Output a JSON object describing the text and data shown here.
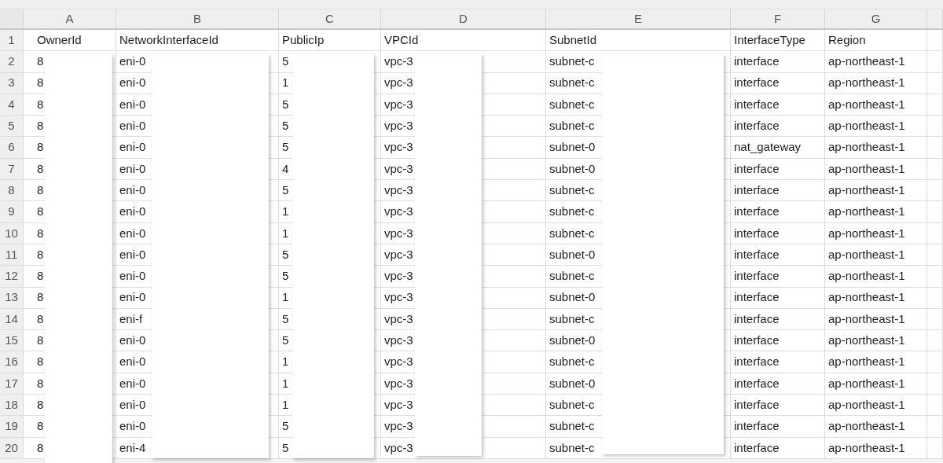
{
  "columns": [
    "A",
    "B",
    "C",
    "D",
    "E",
    "F",
    "G"
  ],
  "rows": [
    {
      "number": "1",
      "cells": [
        "OwnerId",
        "NetworkInterfaceId",
        "PublicIp",
        "VPCId",
        "SubnetId",
        "InterfaceType",
        "Region"
      ]
    },
    {
      "number": "2",
      "cells": [
        "8",
        "eni-0",
        "5",
        "vpc-3",
        "subnet-c",
        "interface",
        "ap-northeast-1"
      ]
    },
    {
      "number": "3",
      "cells": [
        "8",
        "eni-0",
        "1",
        "vpc-3",
        "subnet-c",
        "interface",
        "ap-northeast-1"
      ]
    },
    {
      "number": "4",
      "cells": [
        "8",
        "eni-0",
        "5",
        "vpc-3",
        "subnet-c",
        "interface",
        "ap-northeast-1"
      ]
    },
    {
      "number": "5",
      "cells": [
        "8",
        "eni-0",
        "5",
        "vpc-3",
        "subnet-c",
        "interface",
        "ap-northeast-1"
      ]
    },
    {
      "number": "6",
      "cells": [
        "8",
        "eni-0",
        "5",
        "vpc-3",
        "subnet-0",
        "nat_gateway",
        "ap-northeast-1"
      ]
    },
    {
      "number": "7",
      "cells": [
        "8",
        "eni-0",
        "4",
        "vpc-3",
        "subnet-0",
        "interface",
        "ap-northeast-1"
      ]
    },
    {
      "number": "8",
      "cells": [
        "8",
        "eni-0",
        "5",
        "vpc-3",
        "subnet-c",
        "interface",
        "ap-northeast-1"
      ]
    },
    {
      "number": "9",
      "cells": [
        "8",
        "eni-0",
        "1",
        "vpc-3",
        "subnet-c",
        "interface",
        "ap-northeast-1"
      ]
    },
    {
      "number": "10",
      "cells": [
        "8",
        "eni-0",
        "1",
        "vpc-3",
        "subnet-c",
        "interface",
        "ap-northeast-1"
      ]
    },
    {
      "number": "11",
      "cells": [
        "8",
        "eni-0",
        "5",
        "vpc-3",
        "subnet-0",
        "interface",
        "ap-northeast-1"
      ]
    },
    {
      "number": "12",
      "cells": [
        "8",
        "eni-0",
        "5",
        "vpc-3",
        "subnet-c",
        "interface",
        "ap-northeast-1"
      ]
    },
    {
      "number": "13",
      "cells": [
        "8",
        "eni-0",
        "1",
        "vpc-3",
        "subnet-0",
        "interface",
        "ap-northeast-1"
      ]
    },
    {
      "number": "14",
      "cells": [
        "8",
        "eni-f",
        "5",
        "vpc-3",
        "subnet-c",
        "interface",
        "ap-northeast-1"
      ]
    },
    {
      "number": "15",
      "cells": [
        "8",
        "eni-0",
        "5",
        "vpc-3",
        "subnet-0",
        "interface",
        "ap-northeast-1"
      ]
    },
    {
      "number": "16",
      "cells": [
        "8",
        "eni-0",
        "1",
        "vpc-3",
        "subnet-c",
        "interface",
        "ap-northeast-1"
      ]
    },
    {
      "number": "17",
      "cells": [
        "8",
        "eni-0",
        "1",
        "vpc-3",
        "subnet-0",
        "interface",
        "ap-northeast-1"
      ]
    },
    {
      "number": "18",
      "cells": [
        "8",
        "eni-0",
        "1",
        "vpc-3",
        "subnet-c",
        "interface",
        "ap-northeast-1"
      ]
    },
    {
      "number": "19",
      "cells": [
        "8",
        "eni-0",
        "5",
        "vpc-3",
        "subnet-c",
        "interface",
        "ap-northeast-1"
      ]
    },
    {
      "number": "20",
      "cells": [
        "8",
        "eni-4",
        "5",
        "vpc-3",
        "subnet-c",
        "interface",
        "ap-northeast-1"
      ]
    }
  ]
}
